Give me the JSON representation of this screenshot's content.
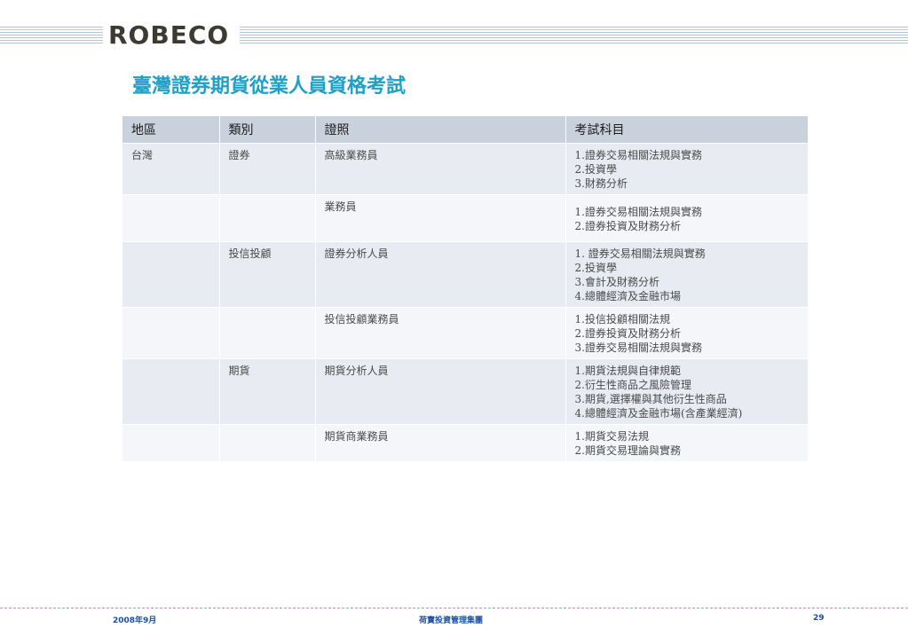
{
  "header": {
    "logo": "ROBECO"
  },
  "title": "臺灣證券期貨從業人員資格考試",
  "table": {
    "headers": [
      "地區",
      "類別",
      "證照",
      "考試科目"
    ],
    "rows": [
      {
        "region": "台灣",
        "category": "證券",
        "license": "高級業務員",
        "subjects": [
          "1.證券交易相關法規與實務",
          "2.投資學",
          "3.財務分析"
        ]
      },
      {
        "region": "",
        "category": "",
        "license": "業務員",
        "subjects": [
          "1.證券交易相關法規與實務",
          "2.證券投資及財務分析"
        ]
      },
      {
        "region": "",
        "category": "投信投顧",
        "license": "證券分析人員",
        "subjects": [
          "1. 證券交易相關法規與實務",
          "2.投資學",
          "3.會計及財務分析",
          "4.總體經濟及金融市場"
        ]
      },
      {
        "region": "",
        "category": "",
        "license": "投信投顧業務員",
        "subjects": [
          "1.投信投顧相關法規",
          "2.證券投資及財務分析",
          "3.證券交易相關法規與實務"
        ]
      },
      {
        "region": "",
        "category": "期貨",
        "license": "期貨分析人員",
        "subjects": [
          "1.期貨法規與自律規範",
          "2.衍生性商品之風險管理",
          "3.期貨,選擇權與其他衍生性商品",
          "4.總體經濟及金融市場(含產業經濟)"
        ]
      },
      {
        "region": "",
        "category": "",
        "license": "期貨商業務員",
        "subjects": [
          "1.期貨交易法規",
          "2.期貨交易理論與實務"
        ]
      }
    ]
  },
  "footer": {
    "date": "2008年9月",
    "company": "荷寶投資管理集團",
    "page": "29"
  }
}
